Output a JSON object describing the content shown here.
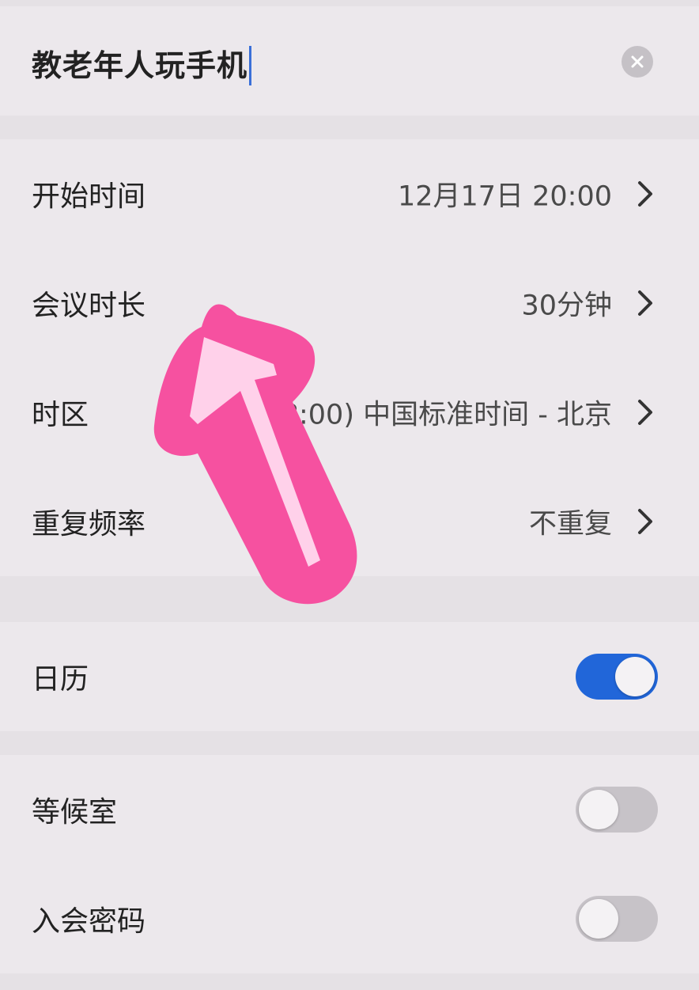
{
  "meeting": {
    "title": "教老年人玩手机"
  },
  "settings": [
    {
      "label": "开始时间",
      "value": "12月17日 20:00"
    },
    {
      "label": "会议时长",
      "value": "30分钟"
    },
    {
      "label": "时区",
      "value": "(GMT+08:00) 中国标准时间 - 北京"
    },
    {
      "label": "重复频率",
      "value": "不重复"
    }
  ],
  "calendar": {
    "label": "日历",
    "on": true
  },
  "waiting_room": {
    "label": "等候室",
    "on": false
  },
  "meeting_password": {
    "label": "入会密码",
    "on": false
  },
  "colors": {
    "accent": "#2166d9",
    "annotation_arrow": "#f651a0",
    "annotation_arrow_fill": "#ffd1ea"
  },
  "icons": {
    "clear": "clear-x-icon",
    "chevron": "chevron-right-icon",
    "annotation": "arrow-up-annotation-icon"
  }
}
